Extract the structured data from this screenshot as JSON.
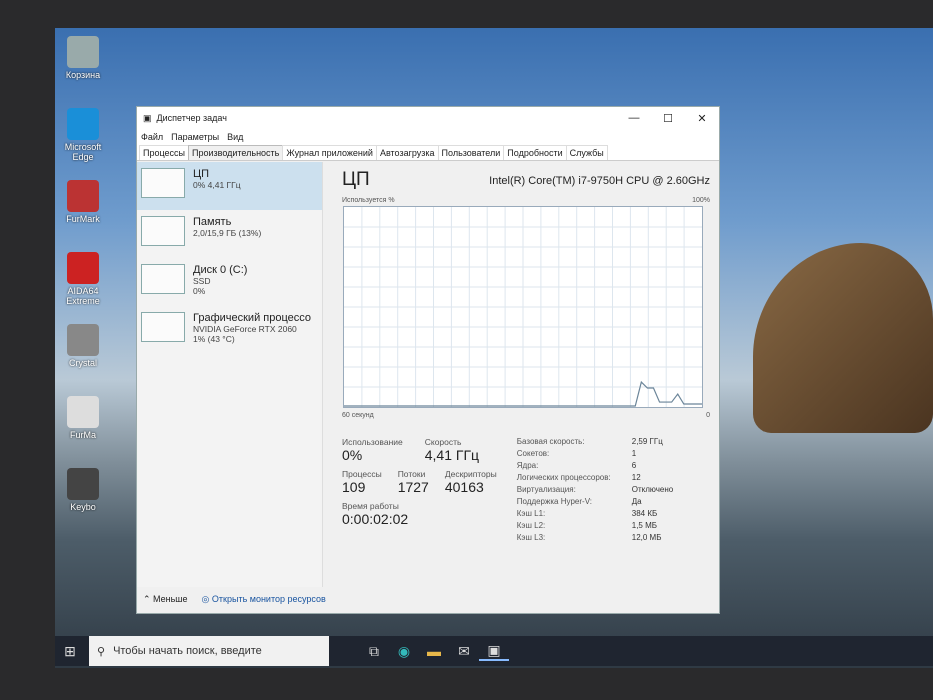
{
  "desktop": {
    "icons": [
      {
        "label": "Корзина",
        "color": "#9aa"
      },
      {
        "label": "Microsoft Edge",
        "color": "#1a8fd8"
      },
      {
        "label": "FurMark",
        "color": "#b33"
      },
      {
        "label": "AIDA64 Extreme",
        "color": "#c22"
      },
      {
        "label": "Crystal",
        "color": "#888"
      },
      {
        "label": "FurMa",
        "color": "#ddd"
      },
      {
        "label": "Keybo",
        "color": "#444"
      }
    ]
  },
  "window": {
    "title": "Диспетчер задач",
    "controls": [
      "—",
      "☐",
      "✕"
    ],
    "menu": [
      "Файл",
      "Параметры",
      "Вид"
    ],
    "tabs": [
      {
        "label": "Процессы"
      },
      {
        "label": "Производительность",
        "active": true
      },
      {
        "label": "Журнал приложений"
      },
      {
        "label": "Автозагрузка"
      },
      {
        "label": "Пользователи"
      },
      {
        "label": "Подробности"
      },
      {
        "label": "Службы"
      }
    ]
  },
  "sidebar": {
    "items": [
      {
        "name": "ЦП",
        "lines": [
          "0% 4,41 ГГц"
        ],
        "selected": true
      },
      {
        "name": "Память",
        "lines": [
          "2,0/15,9 ГБ (13%)"
        ]
      },
      {
        "name": "Диск 0 (C:)",
        "lines": [
          "SSD",
          "0%"
        ]
      },
      {
        "name": "Графический процессо",
        "lines": [
          "NVIDIA GeForce RTX 2060",
          "1% (43 °C)"
        ]
      }
    ]
  },
  "main": {
    "title": "ЦП",
    "cpu_name": "Intel(R) Core(TM) i7-9750H CPU @ 2.60GHz",
    "y_label": "Используется %",
    "y_max_label": "100%",
    "x_left_label": "60 секунд",
    "x_right_label": "0",
    "cpu_history": [
      0,
      0,
      0,
      0,
      0,
      0,
      0,
      0,
      0,
      0,
      0,
      0,
      0,
      0,
      0,
      0,
      0,
      0,
      0,
      0,
      0,
      0,
      0,
      0,
      0,
      0,
      0,
      0,
      0,
      0,
      0,
      0,
      0,
      0,
      0,
      0,
      0,
      0,
      0,
      0,
      0,
      0,
      0,
      0,
      0,
      0,
      0,
      0,
      0,
      12,
      9,
      9,
      2,
      2,
      2,
      6,
      1,
      1,
      1,
      1
    ],
    "stats": {
      "usage_label": "Использование",
      "usage": "0%",
      "speed_label": "Скорость",
      "speed": "4,41 ГГц",
      "proc_label": "Процессы",
      "proc": "109",
      "threads_label": "Потоки",
      "threads": "1727",
      "handles_label": "Дескрипторы",
      "handles": "40163",
      "uptime_label": "Время работы",
      "uptime": "0:00:02:02"
    },
    "specs": [
      [
        "Базовая скорость:",
        "2,59 ГГц"
      ],
      [
        "Сокетов:",
        "1"
      ],
      [
        "Ядра:",
        "6"
      ],
      [
        "Логических процессоров:",
        "12"
      ],
      [
        "Виртуализация:",
        "Отключено"
      ],
      [
        "Поддержка Hyper-V:",
        "Да"
      ],
      [
        "Кэш L1:",
        "384 КБ"
      ],
      [
        "Кэш L2:",
        "1,5 МБ"
      ],
      [
        "Кэш L3:",
        "12,0 МБ"
      ]
    ]
  },
  "footer": {
    "less": "Меньше",
    "monitor": "Открыть монитор ресурсов"
  },
  "taskbar": {
    "search_placeholder": "Чтобы начать поиск, введите"
  }
}
